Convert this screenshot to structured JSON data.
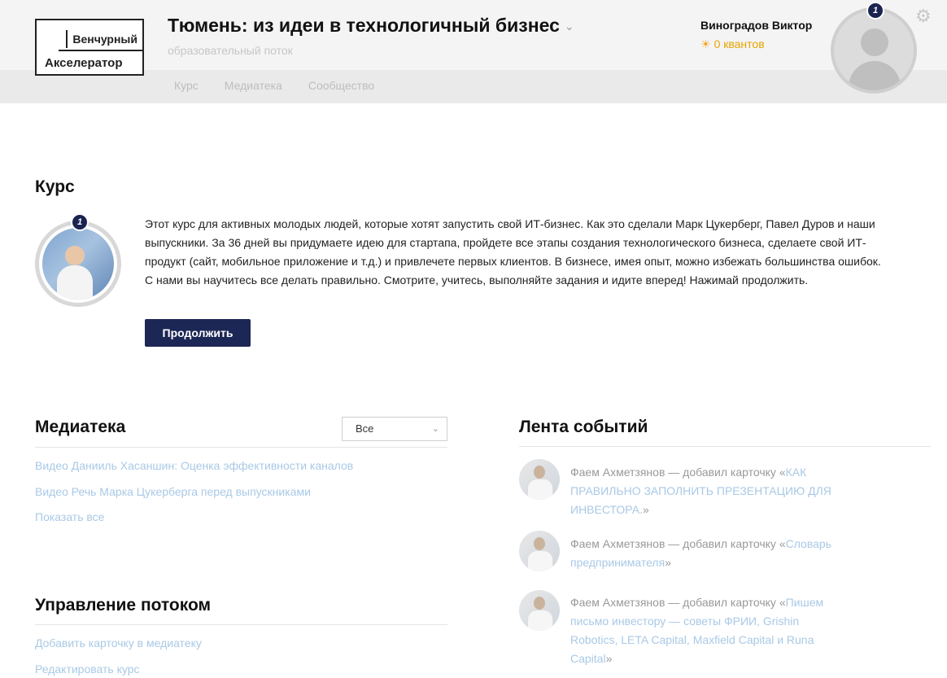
{
  "header": {
    "logo_line1": "Венчурный",
    "logo_line2": "Акселератор",
    "title": "Тюмень: из идеи в технологичный бизнес",
    "subtitle": "образовательный поток",
    "nav": [
      "Курс",
      "Медиатека",
      "Сообщество"
    ],
    "user_name": "Виноградов Виктор",
    "quanta": "0 квантов",
    "badge": "1"
  },
  "course": {
    "heading": "Курс",
    "badge": "1",
    "description": "Этот курс для активных молодых людей, которые хотят запустить свой ИТ-бизнес. Как это сделали Марк Цукерберг, Павел Дуров и наши выпускники. За 36 дней вы придумаете идею для стартапа, пройдете все этапы создания технологического бизнеса, сделаете свой ИТ-продукт (сайт, мобильное приложение и т.д.) и привлечете первых клиентов. В бизнесе, имея опыт, можно избежать большинства ошибок. С нами вы научитесь все делать правильно. Смотрите, учитесь, выполняйте задания и идите вперед! Нажимай продолжить.",
    "button": "Продолжить"
  },
  "media": {
    "heading": "Медиатека",
    "filter_value": "Все",
    "links": [
      "Видео Данииль Хасаншин: Оценка эффективности каналов",
      "Видео Речь Марка Цукерберга перед выпускниками",
      "Показать все"
    ]
  },
  "manage": {
    "heading": "Управление потоком",
    "links": [
      "Добавить карточку в медиатеку",
      "Редактировать курс"
    ]
  },
  "feed": {
    "heading": "Лента событий",
    "items": [
      {
        "author": "Фаем Ахметзянов",
        "action": " — добавил карточку «",
        "card": "КАК ПРАВИЛЬНО ЗАПОЛНИТЬ ПРЕЗЕНТАЦИЮ ДЛЯ ИНВЕСТОРА.",
        "close": "»"
      },
      {
        "author": "Фаем Ахметзянов",
        "action": " — добавил карточку «",
        "card": "Словарь предпринимателя",
        "close": "»"
      },
      {
        "author": "Фаем Ахметзянов",
        "action": " — добавил карточку «",
        "card": "Пишем письмо инвестору — советы ФРИИ, Grishin Robotics, LETA Capital, Maxfield Capital и Runa Capital",
        "close": "»"
      }
    ]
  }
}
